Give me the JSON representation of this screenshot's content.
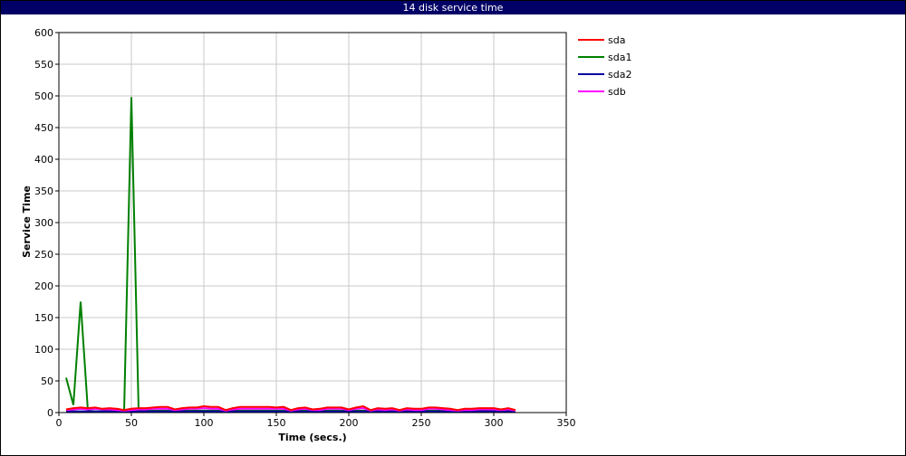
{
  "window": {
    "title": "14 disk service time"
  },
  "colors": {
    "titlebar_bg": "#000066",
    "titlebar_fg": "#ffffff",
    "grid": "#c8c8c8"
  },
  "chart_data": {
    "type": "line",
    "xlabel": "Time (secs.)",
    "ylabel": "Service Time",
    "xlim": [
      0,
      350
    ],
    "ylim": [
      0,
      600
    ],
    "xticks": [
      0,
      50,
      100,
      150,
      200,
      250,
      300,
      350
    ],
    "yticks": [
      0,
      50,
      100,
      150,
      200,
      250,
      300,
      350,
      400,
      450,
      500,
      550,
      600
    ],
    "grid": true,
    "legend_position": "right",
    "series": [
      {
        "name": "sda",
        "color": "#ff0000",
        "points": [
          [
            5,
            5
          ],
          [
            10,
            7
          ],
          [
            15,
            8
          ],
          [
            20,
            7
          ],
          [
            25,
            8
          ],
          [
            30,
            6
          ],
          [
            35,
            7
          ],
          [
            40,
            6
          ],
          [
            45,
            4
          ],
          [
            50,
            6
          ],
          [
            55,
            7
          ],
          [
            60,
            7
          ],
          [
            65,
            8
          ],
          [
            70,
            9
          ],
          [
            75,
            9
          ],
          [
            80,
            5
          ],
          [
            85,
            7
          ],
          [
            90,
            8
          ],
          [
            95,
            8
          ],
          [
            100,
            10
          ],
          [
            105,
            9
          ],
          [
            110,
            9
          ],
          [
            115,
            4
          ],
          [
            120,
            7
          ],
          [
            125,
            9
          ],
          [
            130,
            9
          ],
          [
            135,
            9
          ],
          [
            140,
            9
          ],
          [
            145,
            9
          ],
          [
            150,
            8
          ],
          [
            155,
            9
          ],
          [
            160,
            4
          ],
          [
            165,
            7
          ],
          [
            170,
            8
          ],
          [
            175,
            5
          ],
          [
            180,
            6
          ],
          [
            185,
            8
          ],
          [
            190,
            8
          ],
          [
            195,
            8
          ],
          [
            200,
            5
          ],
          [
            205,
            8
          ],
          [
            210,
            10
          ],
          [
            215,
            4
          ],
          [
            220,
            7
          ],
          [
            225,
            6
          ],
          [
            230,
            7
          ],
          [
            235,
            4
          ],
          [
            240,
            7
          ],
          [
            245,
            6
          ],
          [
            250,
            6
          ],
          [
            255,
            8
          ],
          [
            260,
            8
          ],
          [
            265,
            7
          ],
          [
            270,
            6
          ],
          [
            275,
            4
          ],
          [
            280,
            6
          ],
          [
            285,
            6
          ],
          [
            290,
            7
          ],
          [
            295,
            7
          ],
          [
            300,
            7
          ],
          [
            305,
            5
          ],
          [
            310,
            7
          ],
          [
            315,
            4
          ]
        ]
      },
      {
        "name": "sda1",
        "color": "#008000",
        "points": [
          [
            5,
            55
          ],
          [
            10,
            12
          ],
          [
            15,
            175
          ],
          [
            20,
            3
          ],
          [
            25,
            2
          ],
          [
            30,
            2
          ],
          [
            35,
            2
          ],
          [
            40,
            2
          ],
          [
            45,
            2
          ],
          [
            50,
            498
          ],
          [
            55,
            3
          ],
          [
            60,
            3
          ],
          [
            65,
            3
          ],
          [
            70,
            3
          ],
          [
            80,
            3
          ],
          [
            90,
            3
          ],
          [
            100,
            3
          ],
          [
            110,
            3
          ],
          [
            120,
            3
          ],
          [
            130,
            3
          ],
          [
            140,
            3
          ],
          [
            150,
            3
          ],
          [
            160,
            3
          ],
          [
            170,
            3
          ],
          [
            180,
            3
          ],
          [
            190,
            3
          ],
          [
            200,
            3
          ],
          [
            210,
            3
          ],
          [
            220,
            3
          ],
          [
            230,
            3
          ],
          [
            240,
            3
          ],
          [
            250,
            3
          ],
          [
            260,
            3
          ],
          [
            270,
            3
          ],
          [
            280,
            3
          ],
          [
            290,
            3
          ],
          [
            300,
            3
          ],
          [
            310,
            3
          ],
          [
            315,
            3
          ]
        ]
      },
      {
        "name": "sda2",
        "color": "#0000a0",
        "points": [
          [
            5,
            2
          ],
          [
            50,
            2
          ],
          [
            100,
            2
          ],
          [
            150,
            2
          ],
          [
            200,
            2
          ],
          [
            250,
            2
          ],
          [
            300,
            2
          ],
          [
            315,
            2
          ]
        ]
      },
      {
        "name": "sdb",
        "color": "#ff00ff",
        "points": [
          [
            5,
            4
          ],
          [
            10,
            5
          ],
          [
            15,
            6
          ],
          [
            20,
            5
          ],
          [
            25,
            6
          ],
          [
            30,
            5
          ],
          [
            35,
            5
          ],
          [
            40,
            4
          ],
          [
            45,
            3
          ],
          [
            50,
            4
          ],
          [
            55,
            5
          ],
          [
            60,
            5
          ],
          [
            65,
            6
          ],
          [
            70,
            6
          ],
          [
            75,
            6
          ],
          [
            80,
            4
          ],
          [
            85,
            5
          ],
          [
            90,
            6
          ],
          [
            95,
            6
          ],
          [
            100,
            7
          ],
          [
            105,
            6
          ],
          [
            110,
            6
          ],
          [
            115,
            3
          ],
          [
            120,
            5
          ],
          [
            125,
            6
          ],
          [
            130,
            6
          ],
          [
            135,
            6
          ],
          [
            140,
            6
          ],
          [
            145,
            6
          ],
          [
            150,
            6
          ],
          [
            155,
            6
          ],
          [
            160,
            3
          ],
          [
            165,
            5
          ],
          [
            170,
            6
          ],
          [
            175,
            4
          ],
          [
            180,
            4
          ],
          [
            185,
            6
          ],
          [
            190,
            6
          ],
          [
            195,
            6
          ],
          [
            200,
            4
          ],
          [
            205,
            6
          ],
          [
            210,
            7
          ],
          [
            215,
            3
          ],
          [
            220,
            5
          ],
          [
            225,
            4
          ],
          [
            230,
            5
          ],
          [
            235,
            3
          ],
          [
            240,
            5
          ],
          [
            245,
            4
          ],
          [
            250,
            4
          ],
          [
            255,
            6
          ],
          [
            260,
            6
          ],
          [
            265,
            5
          ],
          [
            270,
            4
          ],
          [
            275,
            3
          ],
          [
            280,
            4
          ],
          [
            285,
            4
          ],
          [
            290,
            5
          ],
          [
            295,
            5
          ],
          [
            300,
            5
          ],
          [
            305,
            4
          ],
          [
            310,
            5
          ],
          [
            315,
            3
          ]
        ]
      }
    ]
  }
}
